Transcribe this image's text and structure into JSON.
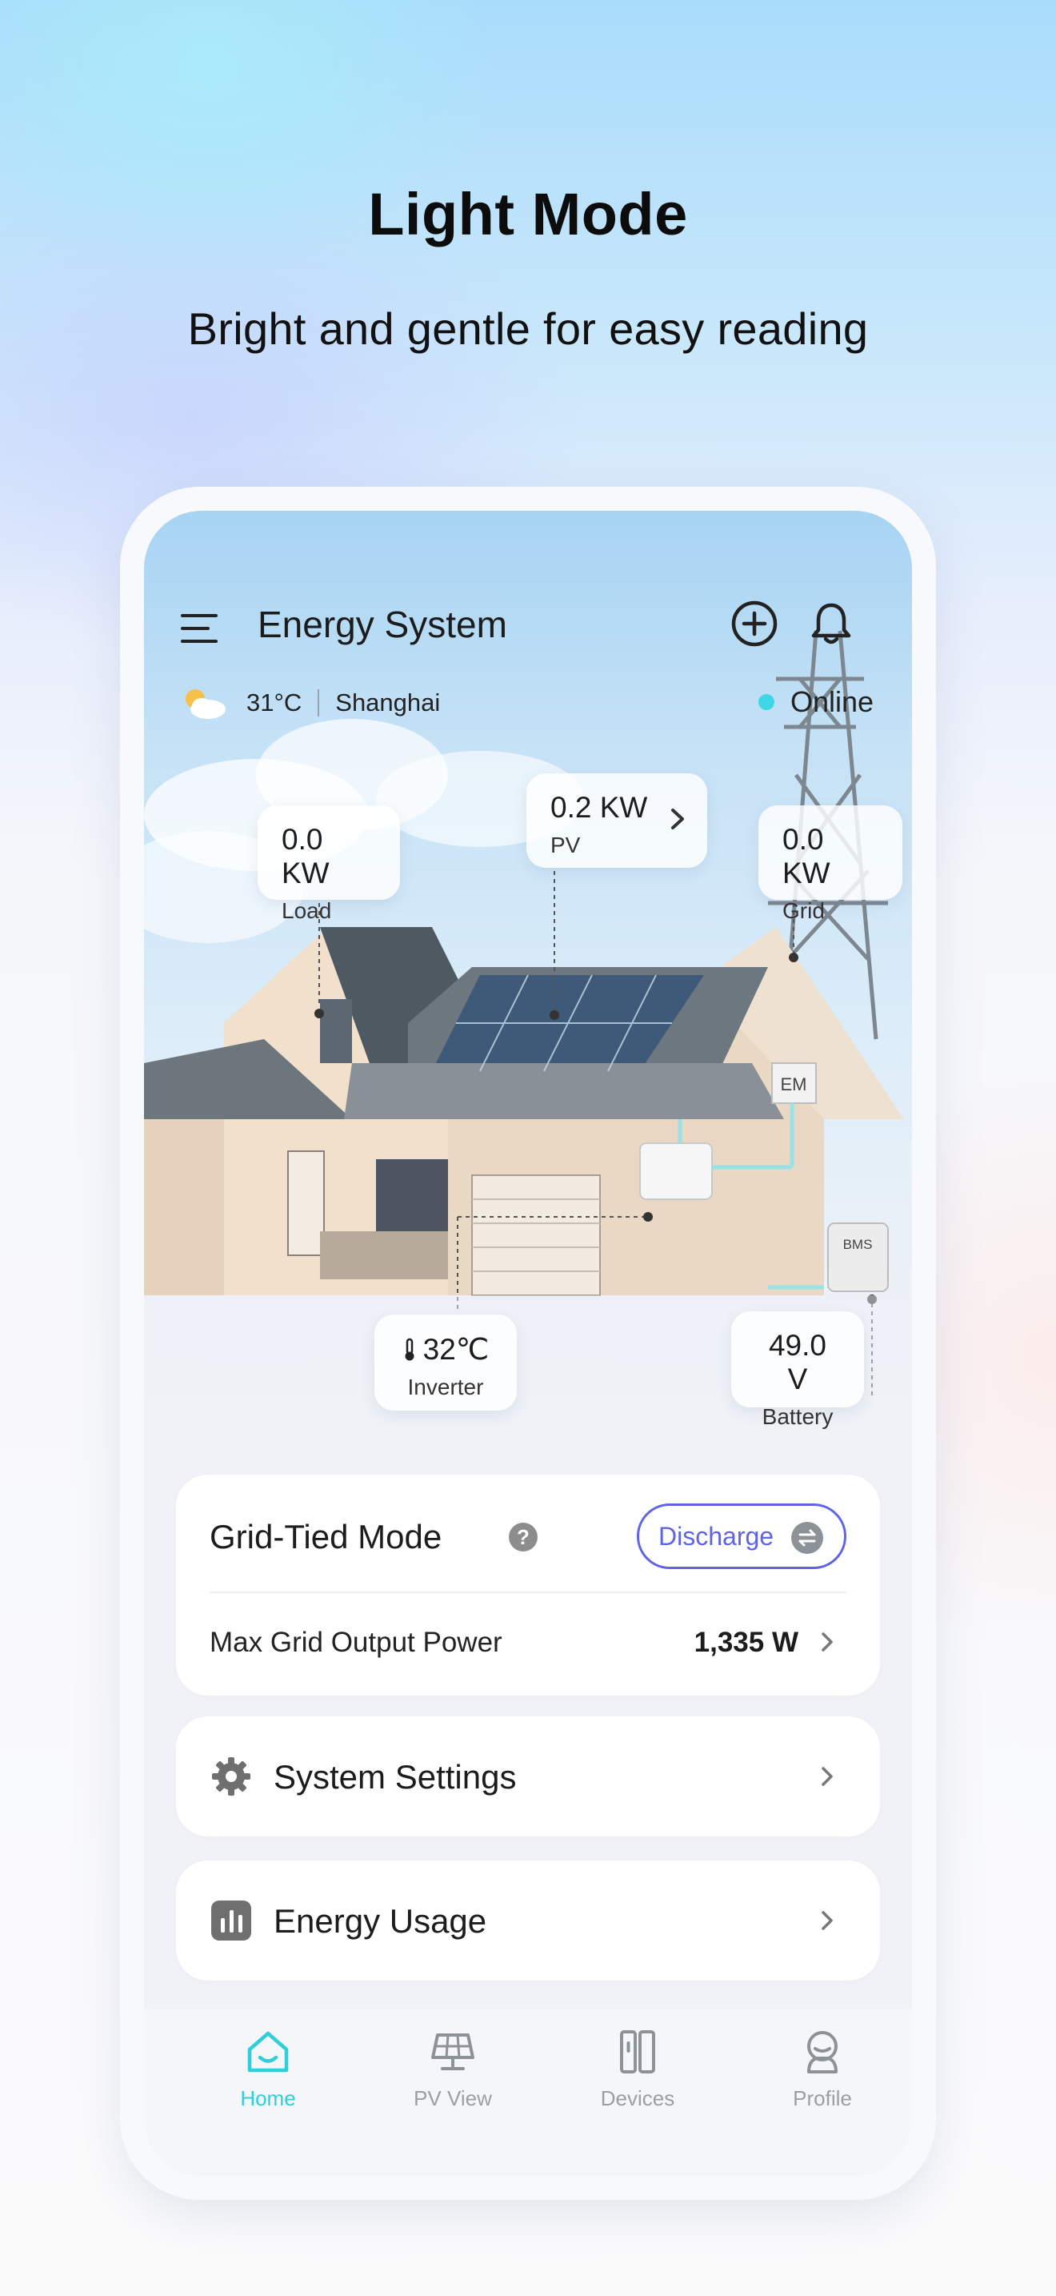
{
  "hero": {
    "title": "Light Mode",
    "subtitle": "Bright and gentle for easy reading"
  },
  "header": {
    "title": "Energy System",
    "menu_icon": "hamburger-menu-icon",
    "add_icon": "plus-circle-icon",
    "bell_icon": "bell-icon"
  },
  "weather": {
    "icon": "partly-cloudy-icon",
    "temperature": "31°C",
    "city": "Shanghai"
  },
  "status": {
    "label": "Online",
    "color": "#3fd6e6"
  },
  "scene": {
    "load": {
      "value": "0.0 KW",
      "label": "Load"
    },
    "pv": {
      "value": "0.2 KW",
      "label": "PV"
    },
    "grid": {
      "value": "0.0 KW",
      "label": "Grid"
    },
    "inverter": {
      "value": "32℃",
      "label": "Inverter",
      "icon": "thermometer-icon"
    },
    "battery": {
      "value": "49.0 V",
      "label": "Battery"
    },
    "em_tag": "EM",
    "bms_tag": "BMS"
  },
  "mode_card": {
    "title": "Grid-Tied Mode",
    "help_icon": "?",
    "action_label": "Discharge",
    "action_color": "#5f63e8",
    "row_label": "Max Grid Output Power",
    "row_value": "1,335 W"
  },
  "menu": {
    "system_settings": "System Settings",
    "energy_usage": "Energy Usage"
  },
  "tabs": [
    {
      "label": "Home",
      "icon": "house-icon",
      "active": true
    },
    {
      "label": "PV View",
      "icon": "solar-panel-icon",
      "active": false
    },
    {
      "label": "Devices",
      "icon": "devices-icon",
      "active": false
    },
    {
      "label": "Profile",
      "icon": "profile-icon",
      "active": false
    }
  ],
  "colors": {
    "accent": "#2fcfd9",
    "inactive": "#9a9ea5"
  }
}
